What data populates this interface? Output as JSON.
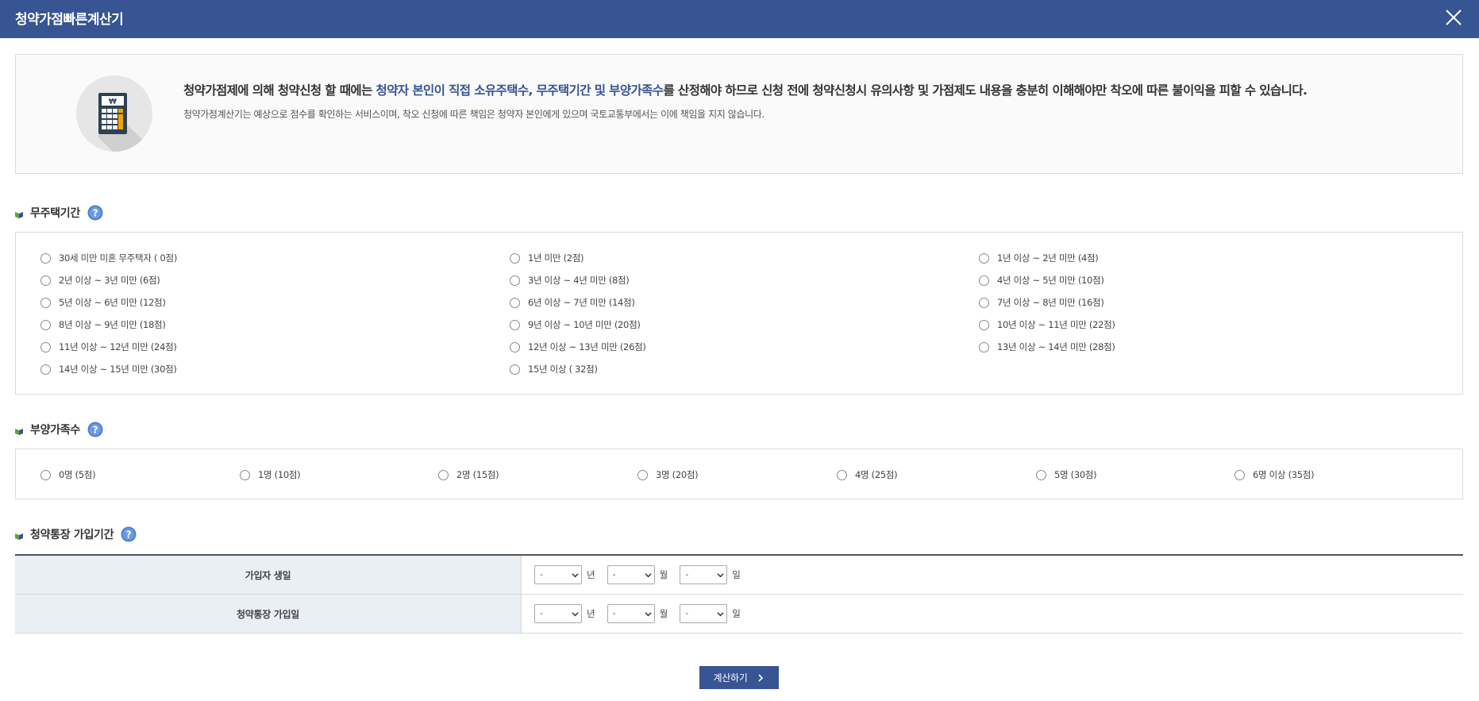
{
  "window": {
    "title": "청약가점빠른계산기"
  },
  "intro": {
    "headline_prefix": "청약가점제에 의해 청약신청 할 때에는 ",
    "headline_highlight": "청약자 본인이 직접 소유주택수, 무주택기간 및 부양가족수",
    "headline_suffix": "를 산정해야 하므로 신청 전에 청약신청시 유의사항 및 가점제도 내용을 충분히 이해해야만 착오에 따른 불이익을 피할 수 있습니다.",
    "sub": "청약가점계산기는 예상으로 점수를 확인하는 서비스이며, 착오 신청에 따른 책임은 청약자 본인에게 있으며 국토교통부에서는 이에 책임을 지지 않습니다.",
    "icon": "calculator-icon",
    "calculator_label": "₩"
  },
  "homeless": {
    "title": "무주택기간",
    "options": [
      "30세 미만 미혼 무주택자 ( 0점)",
      "1년 미만 (2점)",
      "1년 이상 ~ 2년 미만 (4점)",
      "2년 이상 ~ 3년 미만 (6점)",
      "3년 이상 ~ 4년 미만 (8점)",
      "4년 이상 ~ 5년 미만 (10점)",
      "5년 이상 ~ 6년 미만 (12점)",
      "6년 이상 ~ 7년 미만 (14점)",
      "7년 이상 ~ 8년 미만 (16점)",
      "8년 이상 ~ 9년 미만 (18점)",
      "9년 이상 ~ 10년 미만 (20점)",
      "10년 이상 ~ 11년 미만 (22점)",
      "11년 이상 ~ 12년 미만 (24점)",
      "12년 이상 ~ 13년 미만 (26점)",
      "13년 이상 ~ 14년 미만 (28점)",
      "14년 이상 ~ 15년 미만 (30점)",
      "15년 이상 ( 32점)"
    ]
  },
  "dependents": {
    "title": "부양가족수",
    "options": [
      "0명 (5점)",
      "1명 (10점)",
      "2명 (15점)",
      "3명 (20점)",
      "4명 (25점)",
      "5명 (30점)",
      "6명 이상 (35점)"
    ]
  },
  "subscription": {
    "title": "청약통장 가입기간",
    "rows": [
      {
        "label": "가입자 생일",
        "year": "-",
        "month": "-",
        "day": "-"
      },
      {
        "label": "청약통장 가입일",
        "year": "-",
        "month": "-",
        "day": "-"
      }
    ],
    "unit_year": "년",
    "unit_month": "월",
    "unit_day": "일"
  },
  "calculate_button": "계산하기",
  "colors": {
    "header_bg": "#375493",
    "accent_text": "#375493",
    "table_header_bg": "#eaeef5"
  }
}
